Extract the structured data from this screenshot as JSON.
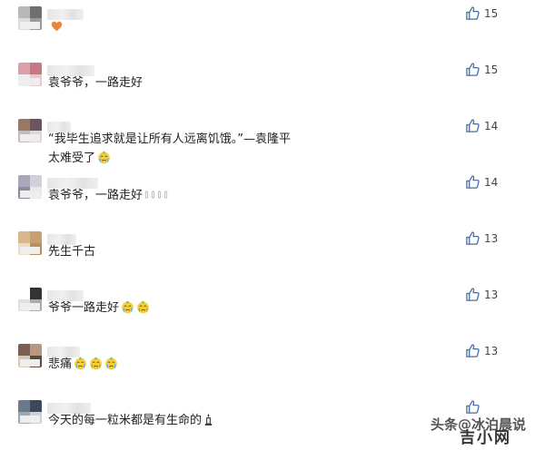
{
  "comments": [
    {
      "text": "",
      "line2": "",
      "likes": "15",
      "emojis": [
        "orange-heart"
      ],
      "avatar_colors": [
        "#b8b8b8",
        "#6f6f6f",
        "#dcdcdc",
        "#9a9a9a"
      ]
    },
    {
      "text": "袁爷爷，一路走好",
      "line2": "",
      "likes": "15",
      "emojis": [],
      "avatar_colors": [
        "#d9a0a8",
        "#c97882",
        "#eeeeee",
        "#e8c8cc"
      ]
    },
    {
      "text": "“我毕生追求就是让所有人远离饥饿。”—袁隆平",
      "line2": "太难受了",
      "likes": "14",
      "emojis": [
        "crying-face"
      ],
      "avatar_colors": [
        "#9a7866",
        "#6a5560",
        "#c8b8c0",
        "#e0d6da"
      ]
    },
    {
      "text": "袁爷爷，一路走好",
      "line2": "",
      "likes": "14",
      "emojis": [
        "folded-hands",
        "folded-hands",
        "folded-hands",
        "folded-hands"
      ],
      "avatar_colors": [
        "#a8a8b8",
        "#d0d0dc",
        "#8c8c9c",
        "#e8e8ee"
      ]
    },
    {
      "text": "先生千古",
      "line2": "",
      "likes": "13",
      "emojis": [],
      "avatar_colors": [
        "#d8b88a",
        "#c8a070",
        "#eedcc0",
        "#b89060"
      ]
    },
    {
      "text": "爷爷一路走好",
      "line2": "",
      "likes": "13",
      "emojis": [
        "crying-face",
        "crying-face"
      ],
      "avatar_colors": [
        "#ffffff",
        "#333333",
        "#e0e0e0",
        "#aaaaaa"
      ]
    },
    {
      "text": "悲痛",
      "line2": "",
      "likes": "13",
      "emojis": [
        "crying-face",
        "crying-face",
        "crying-face"
      ],
      "avatar_colors": [
        "#7a6050",
        "#b89880",
        "#d8c8b8",
        "#5a4a40"
      ]
    },
    {
      "text": "今天的每一粒米都是有生命的",
      "line2": "",
      "likes": "",
      "emojis": [
        "candle"
      ],
      "avatar_colors": [
        "#6a7a8a",
        "#3a4a5a",
        "#9aa8b4",
        "#c8d0d8"
      ]
    }
  ],
  "like_icon": "thumbs-up-icon",
  "colors": {
    "like_icon": "#4a6fa5",
    "text": "#222222",
    "count": "#444444"
  },
  "watermark": {
    "source": "头条",
    "handle": "@冰泊晨说",
    "logo": "吉小网"
  }
}
